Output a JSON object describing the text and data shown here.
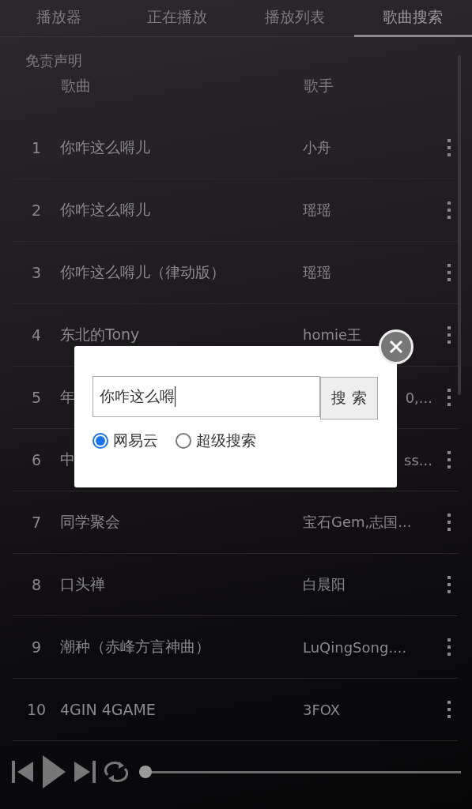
{
  "tabs": [
    {
      "label": "播放器",
      "selected": false
    },
    {
      "label": "正在播放",
      "selected": false
    },
    {
      "label": "播放列表",
      "selected": false
    },
    {
      "label": "歌曲搜索",
      "selected": true
    }
  ],
  "disclaimer": "免责声明",
  "table": {
    "columns": [
      "歌曲",
      "歌手"
    ],
    "rows": [
      {
        "index": "1",
        "title": "你咋这么嘚儿",
        "artist": "小舟"
      },
      {
        "index": "2",
        "title": "你咋这么嘚儿",
        "artist": "瑶瑶"
      },
      {
        "index": "3",
        "title": "你咋这么嘚儿（律动版）",
        "artist": "瑶瑶"
      },
      {
        "index": "4",
        "title": "东北的Tony",
        "artist": "homie王"
      },
      {
        "index": "5",
        "title": "年",
        "artist": "0,...",
        "kind": "covered"
      },
      {
        "index": "6",
        "title": "中",
        "artist": "ss...",
        "kind": "covered"
      },
      {
        "index": "7",
        "title": "同学聚会",
        "artist": "宝石Gem,志国..."
      },
      {
        "index": "8",
        "title": "口头禅",
        "artist": "白晨阳"
      },
      {
        "index": "9",
        "title": "潮种（赤峰方言神曲）",
        "artist": "LuQingSong...."
      },
      {
        "index": "10",
        "title": "4GIN 4GAME",
        "artist": "3FOX"
      }
    ]
  },
  "dialog": {
    "query": "你咋这么嘚",
    "button": "搜 索",
    "sources": [
      {
        "label": "网易云",
        "selected": true
      },
      {
        "label": "超级搜索",
        "selected": false
      }
    ]
  },
  "player": {
    "level": 0
  }
}
